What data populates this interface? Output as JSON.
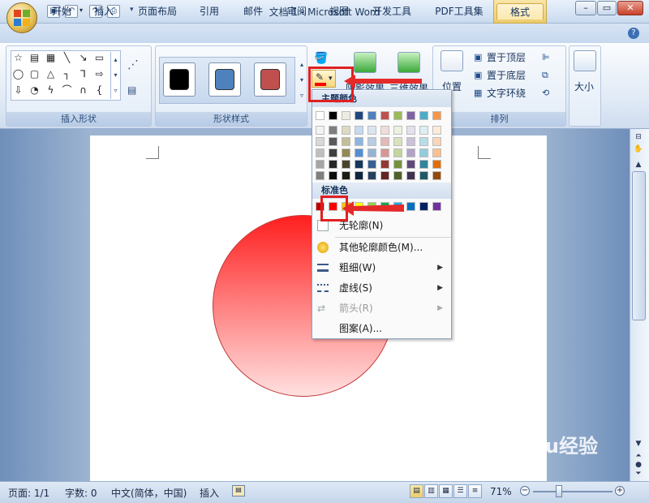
{
  "window": {
    "title": "文档 1 - Microsoft Word",
    "context_tab": "绘图工具"
  },
  "tabs": [
    "开始",
    "插入",
    "页面布局",
    "引用",
    "邮件",
    "审阅",
    "视图",
    "开发工具",
    "PDF工具集",
    "格式"
  ],
  "ribbon": {
    "groups": {
      "insert_shapes": "插入形状",
      "shape_styles": "形状样式",
      "arrange": "排列"
    },
    "style_colors": [
      "#000000",
      "#4f81bd",
      "#c0504d"
    ],
    "buttons": {
      "shadow_effect": "阴影效果",
      "threed_effect": "三维效果",
      "position": "位置",
      "bring_to_front": "置于顶层",
      "send_to_back": "置于底层",
      "text_wrap": "文字环绕",
      "size": "大小"
    }
  },
  "dropdown": {
    "theme_colors_label": "主题颜色",
    "standard_colors_label": "标准色",
    "theme_top_row": [
      "#ffffff",
      "#000000",
      "#eeece1",
      "#1f497d",
      "#4f81bd",
      "#c0504d",
      "#9bbb59",
      "#8064a2",
      "#4bacc6",
      "#f79646"
    ],
    "theme_shades": [
      [
        "#f2f2f2",
        "#7f7f7f",
        "#ddd9c3",
        "#c6d9f0",
        "#dbe5f1",
        "#f2dcdb",
        "#ebf1dd",
        "#e5e0ec",
        "#dbeef3",
        "#fdeada"
      ],
      [
        "#d8d8d8",
        "#595959",
        "#c4bd97",
        "#8db3e2",
        "#b8cce4",
        "#e5b9b7",
        "#d7e3bc",
        "#ccc1d9",
        "#b7dde8",
        "#fbd5b5"
      ],
      [
        "#bfbfbf",
        "#3f3f3f",
        "#938953",
        "#548dd4",
        "#95b3d7",
        "#d99694",
        "#c3d69b",
        "#b2a2c7",
        "#92cddc",
        "#fac08f"
      ],
      [
        "#a5a5a5",
        "#262626",
        "#494429",
        "#17365d",
        "#366092",
        "#953734",
        "#76923c",
        "#5f497a",
        "#31859b",
        "#e36c09"
      ],
      [
        "#7f7f7f",
        "#0c0c0c",
        "#1d1b10",
        "#0f243e",
        "#244061",
        "#632423",
        "#4f6128",
        "#3f3151",
        "#205867",
        "#974806"
      ]
    ],
    "standard_colors": [
      "#c00000",
      "#ff0000",
      "#ffc000",
      "#ffff00",
      "#92d050",
      "#00b050",
      "#00b0f0",
      "#0070c0",
      "#002060",
      "#7030a0"
    ],
    "items": {
      "no_outline": "无轮廓(N)",
      "more_colors": "其他轮廓颜色(M)...",
      "weight": "粗细(W)",
      "dashes": "虚线(S)",
      "arrows": "箭头(R)",
      "pattern": "图案(A)..."
    }
  },
  "status": {
    "page": "页面: 1/1",
    "words": "字数: 0",
    "language": "中文(简体，中国)",
    "mode": "插入",
    "zoom": "71%"
  },
  "watermark": "Baidu经验"
}
